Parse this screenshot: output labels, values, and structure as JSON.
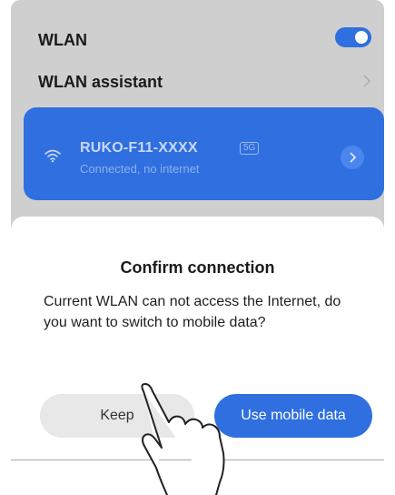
{
  "settings": {
    "wlan_label": "WLAN",
    "wlan_toggle_on": true,
    "assistant_label": "WLAN assistant"
  },
  "network": {
    "name": "RUKO-F11-XXXX",
    "band_badge": "5G",
    "status": "Connected, no internet"
  },
  "dialog": {
    "title": "Confirm connection",
    "message": "Current WLAN can not access the Internet, do you want to switch to mobile data?",
    "keep_label": "Keep",
    "mobile_label": "Use mobile data"
  },
  "colors": {
    "accent": "#2f6fe0",
    "overlay": "#cfcfcf",
    "keep_button": "#e8e8e8"
  }
}
